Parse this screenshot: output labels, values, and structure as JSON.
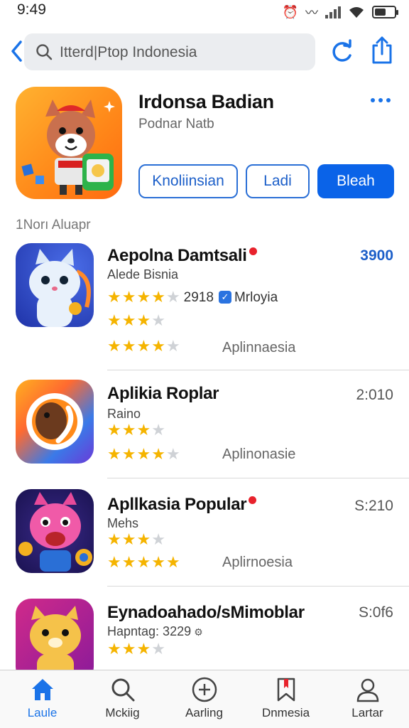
{
  "status": {
    "time": "9:49"
  },
  "search": {
    "query": "Itterd|Ptop Indonesia"
  },
  "featured": {
    "title": "Irdonsa Badian",
    "subtitle": "Podnar Natb",
    "buttons": [
      "Knoliinsian",
      "Ladi",
      "Bleah"
    ]
  },
  "section": {
    "label": "1Norı Aluapr"
  },
  "apps": [
    {
      "name": "Aepolna Damtsali",
      "subtitle": "Alede Bisnia",
      "price": "3900",
      "rating_count": "2918",
      "publisher": "Mrloyia",
      "category": "Aplinnaesia",
      "ratings": [
        3.5,
        3,
        4.5
      ]
    },
    {
      "name": "Aplikia Roplar",
      "subtitle": "Raino",
      "price": "2:010",
      "category": "Aplinonasie",
      "ratings": [
        3,
        4.5
      ]
    },
    {
      "name": "Apllkasia Popular",
      "subtitle": "Mehs",
      "price": "S:210",
      "category": "Aplirnoesia",
      "ratings": [
        3,
        5
      ]
    },
    {
      "name": "Eynadoahado/sMimoblar",
      "subtitle": "Hapntag: 3229",
      "price": "S:0f6",
      "ratings": [
        3
      ]
    }
  ],
  "tabs": [
    {
      "label": "Laule",
      "icon": "home-icon"
    },
    {
      "label": "Mckiig",
      "icon": "search-icon"
    },
    {
      "label": "Aarling",
      "icon": "add-circle-icon"
    },
    {
      "label": "Dnmesia",
      "icon": "bookmark-icon"
    },
    {
      "label": "Lartar",
      "icon": "person-icon"
    }
  ],
  "colors": {
    "accent": "#0a63e8",
    "star": "#f5b400",
    "star_empty": "#cfd2d6"
  }
}
